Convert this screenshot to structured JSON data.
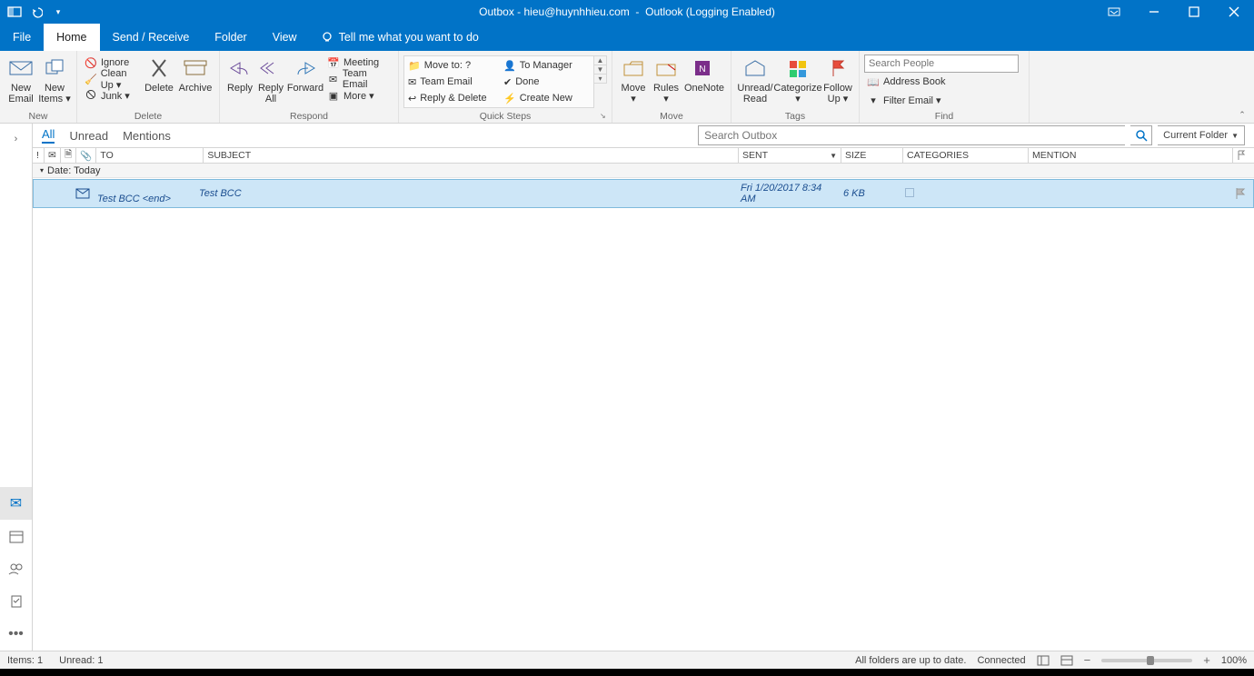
{
  "title": {
    "folder": "Outbox",
    "email": "hieu@huynhhieu.com",
    "app": "Outlook (Logging Enabled)"
  },
  "tabs": {
    "file": "File",
    "home": "Home",
    "sendreceive": "Send / Receive",
    "folder": "Folder",
    "view": "View",
    "tell": "Tell me what you want to do"
  },
  "ribbon": {
    "new": {
      "email": "New\nEmail",
      "items": "New\nItems ▾",
      "group": "New"
    },
    "delete": {
      "ignore": "Ignore",
      "cleanup": "Clean Up ▾",
      "junk": "Junk ▾",
      "del": "Delete",
      "archive": "Archive",
      "group": "Delete"
    },
    "respond": {
      "reply": "Reply",
      "replyall": "Reply\nAll",
      "forward": "Forward",
      "meeting": "Meeting",
      "teamemail": "Team Email",
      "more": "More ▾",
      "group": "Respond"
    },
    "quick": {
      "moveto": "Move to: ?",
      "tomanager": "To Manager",
      "team": "Team Email",
      "done": "Done",
      "replydel": "Reply & Delete",
      "create": "Create New",
      "group": "Quick Steps"
    },
    "move": {
      "move": "Move\n▾",
      "rules": "Rules\n▾",
      "onenote": "OneNote",
      "group": "Move"
    },
    "tags": {
      "unread": "Unread/\nRead",
      "cat": "Categorize\n▾",
      "follow": "Follow\nUp ▾",
      "group": "Tags"
    },
    "find": {
      "placeholder": "Search People",
      "address": "Address Book",
      "filter": "Filter Email ▾",
      "group": "Find"
    }
  },
  "filters": {
    "all": "All",
    "unread": "Unread",
    "mentions": "Mentions"
  },
  "search": {
    "placeholder": "Search Outbox",
    "scope": "Current Folder"
  },
  "cols": {
    "to": "TO",
    "subject": "SUBJECT",
    "sent": "SENT",
    "size": "SIZE",
    "cat": "CATEGORIES",
    "mention": "MENTION"
  },
  "group_today": "Date: Today",
  "message": {
    "to": "Test BCC <end>",
    "subject": "Test BCC",
    "sent": "Fri 1/20/2017 8:34 AM",
    "size": "6 KB"
  },
  "status": {
    "items": "Items: 1",
    "unread": "Unread: 1",
    "sync": "All folders are up to date.",
    "conn": "Connected",
    "zoom": "100%"
  }
}
